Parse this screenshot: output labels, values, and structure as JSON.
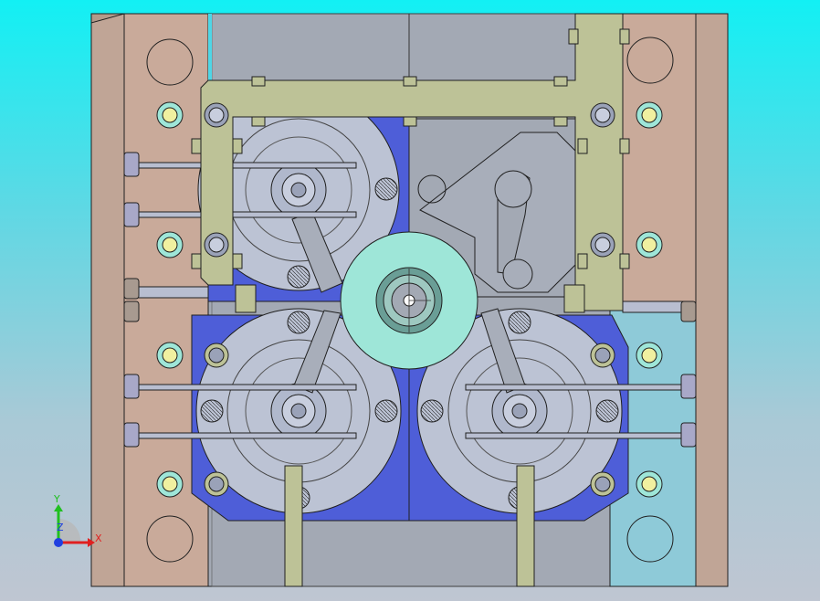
{
  "viewport": {
    "background_top": "#12f0f4",
    "background_bottom": "#bfc6d2"
  },
  "colors": {
    "outer_plate": "#c4a898",
    "mid_plate": "#c9aa9a",
    "center_block": "#a3a9b4",
    "cavity_insert": "#bcc3d4",
    "dark_blue_block": "#4e5ed8",
    "frame": "#bdc297",
    "sprue_bushing": "#9ee6d8",
    "cyan_block": "#8ecad8",
    "guide_ring": "#f0f0a0",
    "outline": "#202020"
  },
  "model": {
    "cavity_count": 3,
    "component": "mould-assembly"
  },
  "triad": {
    "x_label": "X",
    "y_label": "Y",
    "z_label": "Z",
    "x_color": "#e02020",
    "y_color": "#20c020",
    "z_color": "#2040e0"
  }
}
